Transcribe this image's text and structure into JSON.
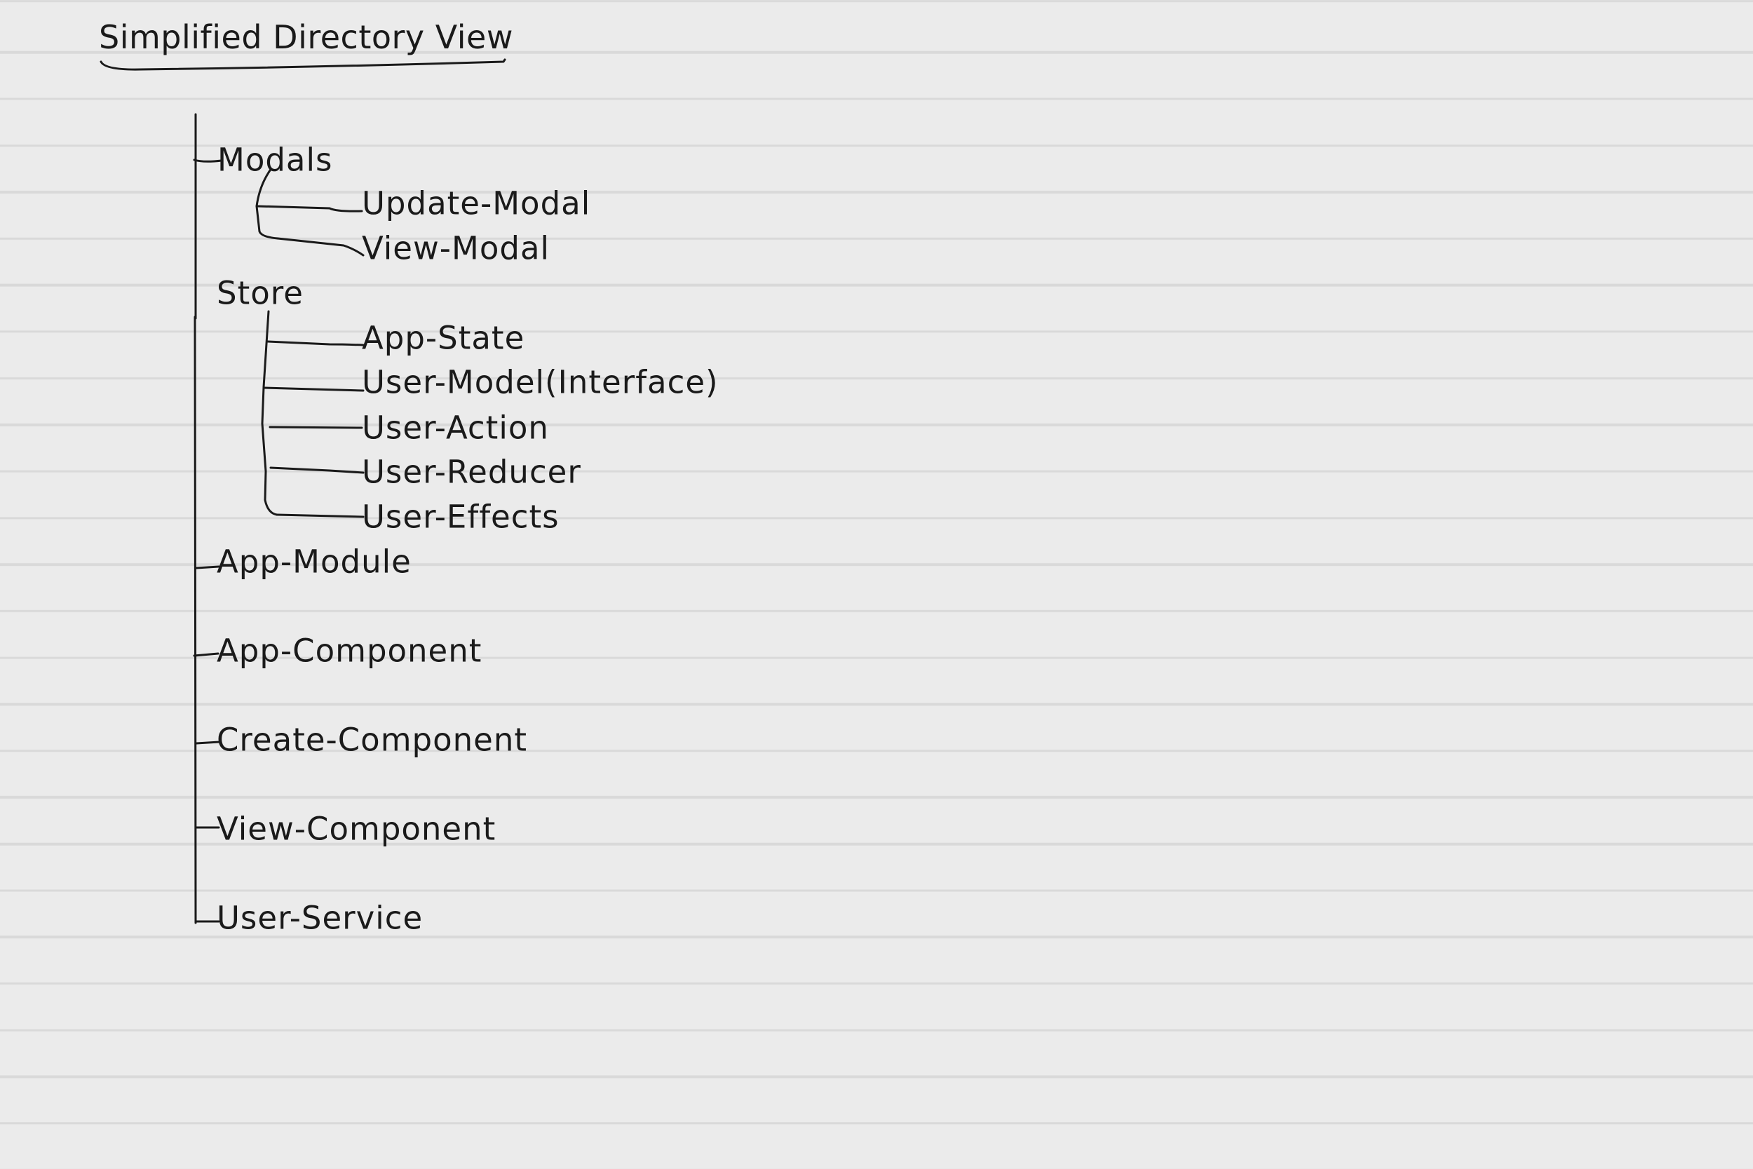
{
  "title": "Simplified Directory View",
  "tree": {
    "modals": {
      "label": "Modals",
      "children": [
        "Update-Modal",
        "View-Modal"
      ]
    },
    "store": {
      "label": "Store",
      "children": [
        "App-State",
        "User-Model(Interface)",
        "User-Action",
        "User-Reducer",
        "User-Effects"
      ]
    },
    "app_module": "App-Module",
    "app_component": "App-Component",
    "create_component": "Create-Component",
    "view_component": "View-Component",
    "user_service": "User-Service"
  }
}
